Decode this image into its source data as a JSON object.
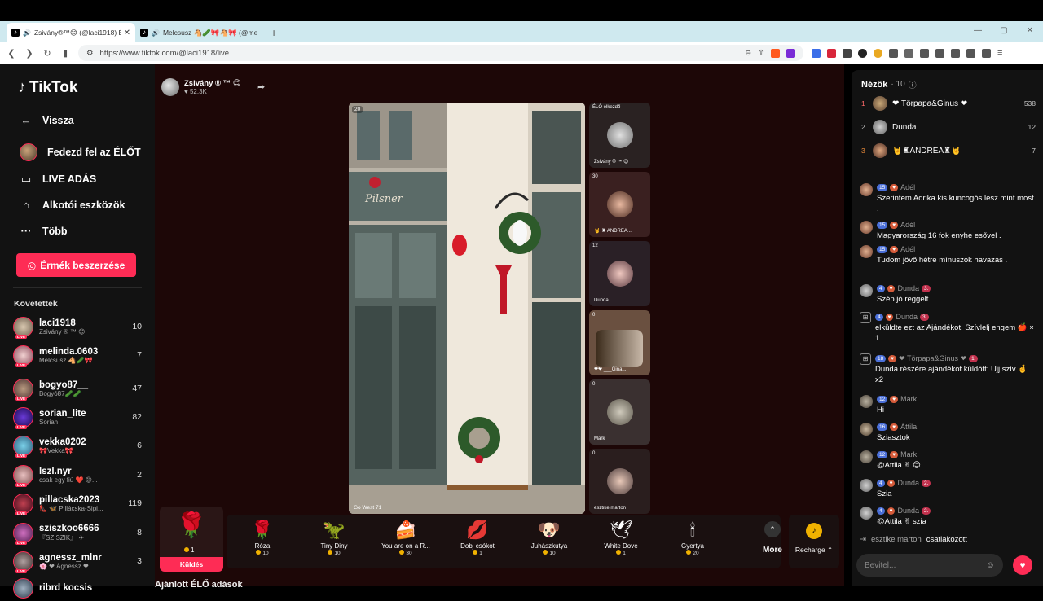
{
  "browser": {
    "tabs": [
      {
        "title": "Zsivány®™😊 (@laci1918) Él",
        "active": true
      },
      {
        "title": "Melcsusz 🐴🥒🎀🐴🎀 (@me",
        "active": false
      }
    ],
    "url": "https://www.tiktok.com/@laci1918/live"
  },
  "sidebar": {
    "logo": "TikTok",
    "back": "Vissza",
    "nav": [
      "Fedezd fel az ÉLŐT",
      "LIVE ADÁS",
      "Alkotói eszközök",
      "Több"
    ],
    "coins_button": "Érmék beszerzése",
    "following_title": "Követettek",
    "following": [
      {
        "name": "laci1918",
        "sub": "Zsivány ® ™ 😊",
        "count": "10"
      },
      {
        "name": "melinda.0603",
        "sub": "Melcsusz 🐴🥒🎀...",
        "count": "7"
      },
      {
        "name": "bogyo87__",
        "sub": "Bogyó87🥒🥒",
        "count": "47"
      },
      {
        "name": "sorian_lite",
        "sub": "Sorian",
        "count": "82"
      },
      {
        "name": "vekka0202",
        "sub": "🎀Vekka🎀",
        "count": "6"
      },
      {
        "name": "lszl.nyr",
        "sub": "csak egy fiú ❤️ 😊...",
        "count": "2"
      },
      {
        "name": "pillacska2023",
        "sub": "👠 🦋 Pillácska-Sipi...",
        "count": "119"
      },
      {
        "name": "sziszkoo6666",
        "sub": "『SZISZIK』 ✈",
        "count": "8"
      },
      {
        "name": "agnessz_mlnr",
        "sub": "🌸 ❤ Ágnessz ❤...",
        "count": "3"
      },
      {
        "name": "ribrd kocsis",
        "sub": "",
        "count": ""
      }
    ]
  },
  "stage": {
    "host_name": "Zsivány ® ™ 😊",
    "host_likes": "♥ 52.3K",
    "video_viewers": "20",
    "video_caption": "Go West 71",
    "thumbs": [
      {
        "label": "ÉLŐ elkezdő",
        "name": "Zsivány ® ™ 😊",
        "count": ""
      },
      {
        "label": "",
        "name": "🤘 ♜ ANDREA...",
        "count": "30"
      },
      {
        "label": "",
        "name": "Dunda",
        "count": "12"
      },
      {
        "label": "",
        "name": "❤❤ ___Gina...",
        "count": "0"
      },
      {
        "label": "",
        "name": "Mark",
        "count": "0"
      },
      {
        "label": "",
        "name": "esztike marton",
        "count": "0"
      }
    ],
    "featured_gift": {
      "price": "1",
      "send": "Küldés"
    },
    "gifts": [
      {
        "name": "Róza",
        "price": "10",
        "icon": "🌹"
      },
      {
        "name": "Tiny Diny",
        "price": "10",
        "icon": "🦖"
      },
      {
        "name": "You are on a R...",
        "price": "30",
        "icon": "🍰"
      },
      {
        "name": "Dobj csókot",
        "price": "1",
        "icon": "💋"
      },
      {
        "name": "Juhászkutya",
        "price": "10",
        "icon": "🐶"
      },
      {
        "name": "White Dove",
        "price": "1",
        "icon": "🕊"
      },
      {
        "name": "Gyertya",
        "price": "20",
        "icon": "🕯"
      }
    ],
    "more": "More",
    "recharge": "Recharge ⌃",
    "bottom_text": "Ajánlott ÉLŐ adások"
  },
  "chat": {
    "viewers_title": "Nézők",
    "viewers_count": "· 10",
    "top_viewers": [
      {
        "rank": "1",
        "name": "❤ Törpapa&Ginus ❤",
        "score": "538"
      },
      {
        "rank": "2",
        "name": "Dunda",
        "score": "12"
      },
      {
        "rank": "3",
        "name": "🤘♜ANDREA♜🤘",
        "score": "7"
      }
    ],
    "messages": [
      {
        "lvl": "15",
        "user": "Adél",
        "text": "Szerintem Adrika kis kuncogós lesz mint most ."
      },
      {
        "lvl": "15",
        "user": "Adél",
        "text": "Magyarország 16 fok enyhe esővel ."
      },
      {
        "lvl": "15",
        "user": "Adél",
        "text": "Tudom jövő hétre mínuszok havazás ."
      },
      {
        "lvl": "4",
        "user": "Dunda",
        "badge": "3.",
        "text": "Szép jó reggelt"
      },
      {
        "lvl": "4",
        "user": "Dunda",
        "badge": "3.",
        "text": "elküldte ezt az Ajándékot: Szívlelj engem 🍎 × 1"
      },
      {
        "lvl": "18",
        "user": "❤ Törpapa&Ginus ❤",
        "badge": "1.",
        "text": "Dunda részére ajándékot küldött: Ujj szív 🤞 x2"
      },
      {
        "lvl": "12",
        "user": "Mark",
        "text": "Hi"
      },
      {
        "lvl": "16",
        "user": "Attila",
        "text": "Sziasztok"
      },
      {
        "lvl": "12",
        "user": "Mark",
        "text": "@Attila ✌ 😊"
      },
      {
        "lvl": "4",
        "user": "Dunda",
        "badge": "2.",
        "text": "Szia"
      },
      {
        "lvl": "4",
        "user": "Dunda",
        "badge": "2.",
        "text": "@Attila ✌ szia"
      }
    ],
    "join_name": "esztike marton",
    "join_text": "csatlakozott",
    "input_placeholder": "Bevitel..."
  }
}
